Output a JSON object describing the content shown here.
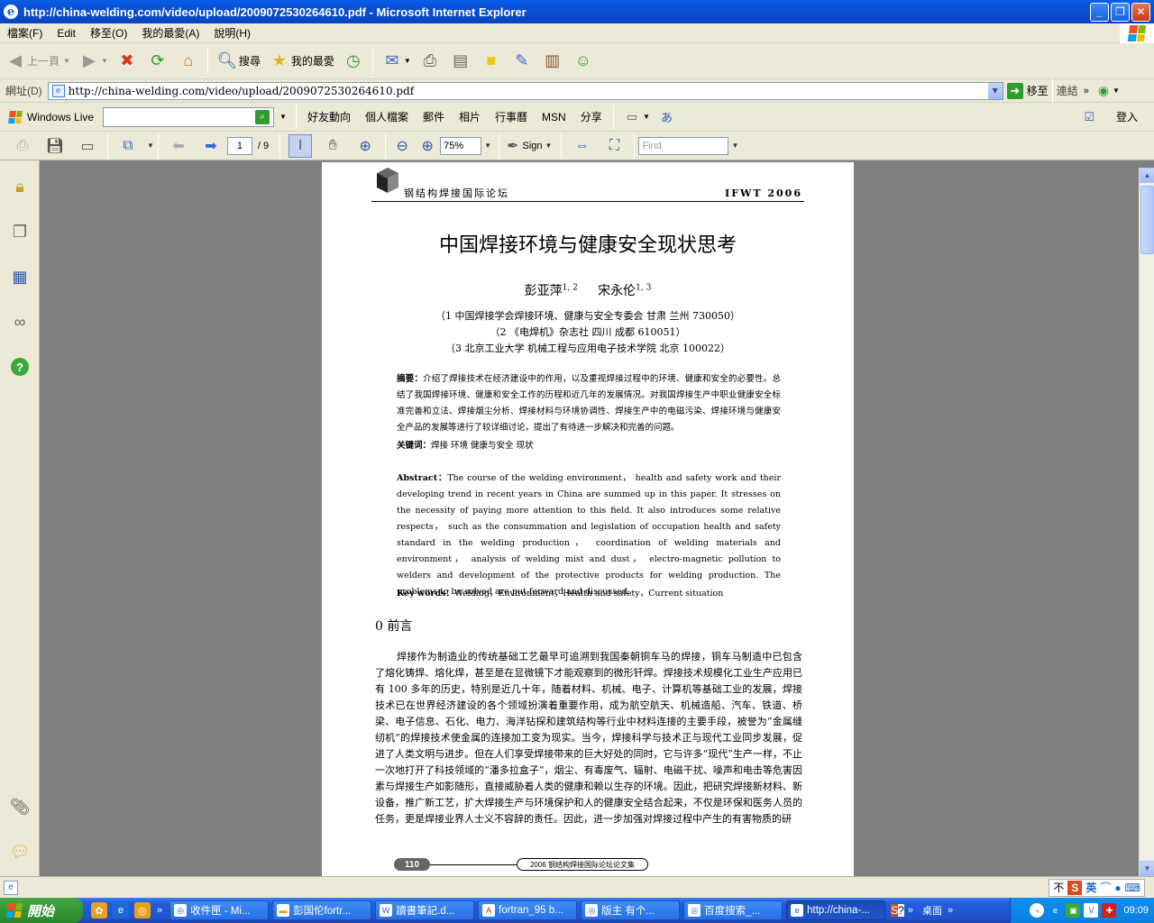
{
  "window": {
    "title": "http://china-welding.com/video/upload/2009072530264610.pdf - Microsoft Internet Explorer"
  },
  "menu": [
    "檔案(F)",
    "Edit",
    "移至(O)",
    "我的最愛(A)",
    "說明(H)"
  ],
  "toolbar": {
    "back_label": "上一頁",
    "search_label": "搜尋",
    "favorites_label": "我的最愛"
  },
  "address": {
    "label": "網址(D)",
    "url": "http://china-welding.com/video/upload/2009072530264610.pdf",
    "go_label": "移至",
    "links_label": "連結"
  },
  "live": {
    "brand": "Windows Live",
    "links": [
      "好友動向",
      "個人檔案",
      "郵件",
      "相片",
      "行事曆",
      "MSN",
      "分享"
    ],
    "signin_label": "登入"
  },
  "pdf_toolbar": {
    "page_current": "1",
    "page_total": "/ 9",
    "zoom": "75%",
    "sign_label": "Sign",
    "find_placeholder": "Find"
  },
  "document": {
    "header_left": "钢结构焊接国际论坛",
    "header_right": "IFWT 2006",
    "title": "中国焊接环境与健康安全现状思考",
    "author1": "彭亚萍",
    "author1_sup": "1, 2",
    "author2": "宋永伦",
    "author2_sup": "1, 3",
    "affiliations": [
      "（1  中国焊接学会焊接环境、健康与安全专委会    甘肃    兰州    730050）",
      "（2  《电焊机》杂志社    四川    成都    610051）",
      "（3  北京工业大学    机械工程与应用电子技术学院    北京    100022）"
    ],
    "abstract_cn_label": "摘要：",
    "abstract_cn": "介绍了焊接技术在经济建设中的作用，以及重视焊接过程中的环境、健康和安全的必要性。总结了我国焊接环境、健康和安全工作的历程和近几年的发展情况。对我国焊接生产中职业健康安全标准完善和立法、焊接烟尘分析、焊接材料与环境协调性、焊接生产中的电磁污染、焊接环境与健康安全产品的发展等进行了较详细讨论，提出了有待进一步解决和完善的问题。",
    "keywords_cn_label": "关键词：",
    "keywords_cn": "焊接    环境    健康与安全    现状",
    "abstract_en_label": "Abstract：",
    "abstract_en": "The course of the welding environment，  health and safety work and their developing trend in recent years in China are summed up in this paper. It stresses on the necessity of paying more attention to this field. It also introduces some relative respects，  such as the consummation and legislation of occupation health and safety standard in the welding production，  coordination of welding materials and environment，  analysis of welding mist and dust，  electro-magnetic pollution to welders and development of the protective products for welding production. The problems to be solved are put forward and discussed.",
    "keywords_en_label": "Key words：",
    "keywords_en": "Welding，Environment，Health and safety，Current situation",
    "section_title": "0    前言",
    "body": "焊接作为制造业的传统基础工艺最早可追溯到我国秦朝铜车马的焊接，铜车马制造中已包含了熔化铸焊、熔化焊，甚至是在显微镜下才能观察到的微形钎焊。焊接技术规模化工业生产应用已有 100 多年的历史，特别是近几十年，随着材料、机械、电子、计算机等基础工业的发展，焊接技术已在世界经济建设的各个领域扮演着重要作用，成为航空航天、机械造船、汽车、铁道、桥梁、电子信息、石化、电力、海洋钻探和建筑结构等行业中材料连接的主要手段，被誉为“金属缝纫机”的焊接技术使金属的连接加工变为现实。当今，焊接科学与技术正与现代工业同步发展，促进了人类文明与进步。但在人们享受焊接带来的巨大好处的同时，它与许多“现代”生产一样，不止一次地打开了科技领域的“潘多拉盒子”，烟尘、有毒废气、辐射、电磁干扰、噪声和电击等危害因素与焊接生产如影随形，直接威胁着人类的健康和赖以生存的环境。因此，把研究焊接新材料、新设备，推广新工艺，扩大焊接生产与环境保护和人的健康安全结合起来，不仅是环保和医务人员的任务，更是焊接业界人士义不容辞的责任。因此，进一步加强对焊接过程中产生的有害物质的研",
    "footer_page": "110",
    "footer_name": "2006 钢结构焊接国际论坛论文集"
  },
  "statusbar": {
    "ime_label": "不",
    "ime_lang": "英"
  },
  "taskbar": {
    "start_label": "開始",
    "tasks": [
      {
        "label": "收件匣 - Mi...",
        "icon": "outlook-icon",
        "active": false
      },
      {
        "label": "彭国伦fortr...",
        "icon": "folder-icon",
        "active": false
      },
      {
        "label": "讀書筆記.d...",
        "icon": "word-icon",
        "active": false
      },
      {
        "label": "fortran_95 b...",
        "icon": "pdf-icon",
        "active": false
      },
      {
        "label": "版主 有个...",
        "icon": "browser-icon",
        "active": false
      },
      {
        "label": "百度搜索_...",
        "icon": "browser-icon",
        "active": false
      },
      {
        "label": "http://china-...",
        "icon": "ie-icon",
        "active": true
      }
    ],
    "desktop_label": "桌面",
    "clock": "09:09"
  },
  "colors": {
    "title_blue": "#0b4fd0",
    "taskbar_blue": "#245edb",
    "start_green": "#329632",
    "doc_background": "#7f7f7f"
  }
}
